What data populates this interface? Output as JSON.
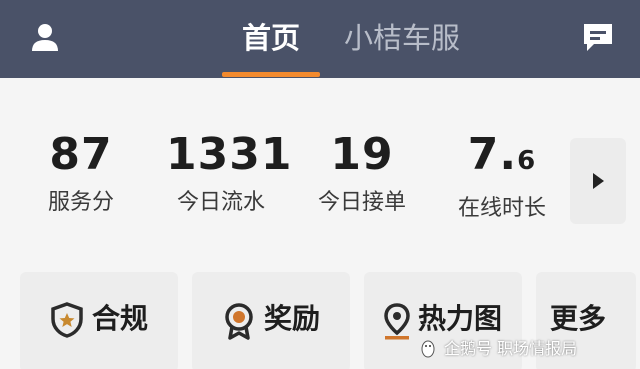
{
  "header": {
    "tabs": [
      {
        "label": "首页",
        "active": true
      },
      {
        "label": "小桔车服",
        "active": false
      }
    ],
    "left_icon": "user-icon",
    "right_icon": "message-icon",
    "accent_color": "#f28a2e",
    "background_color": "#4a5268"
  },
  "stats": [
    {
      "value": "87",
      "label": "服务分"
    },
    {
      "value": "1331",
      "label": "今日流水"
    },
    {
      "value": "19",
      "label": "今日接单"
    },
    {
      "value": "7.",
      "value_suffix": "6",
      "label": "在线时长"
    }
  ],
  "more_stats_icon": "arrow-right-icon",
  "shortcuts": [
    {
      "label": "合规",
      "icon": "shield-star-icon"
    },
    {
      "label": "奖励",
      "icon": "medal-icon"
    },
    {
      "label": "热力图",
      "icon": "location-pin-icon"
    },
    {
      "label": "更多",
      "icon": ""
    }
  ],
  "watermark": {
    "text": "企鹅号 职场情报局"
  }
}
